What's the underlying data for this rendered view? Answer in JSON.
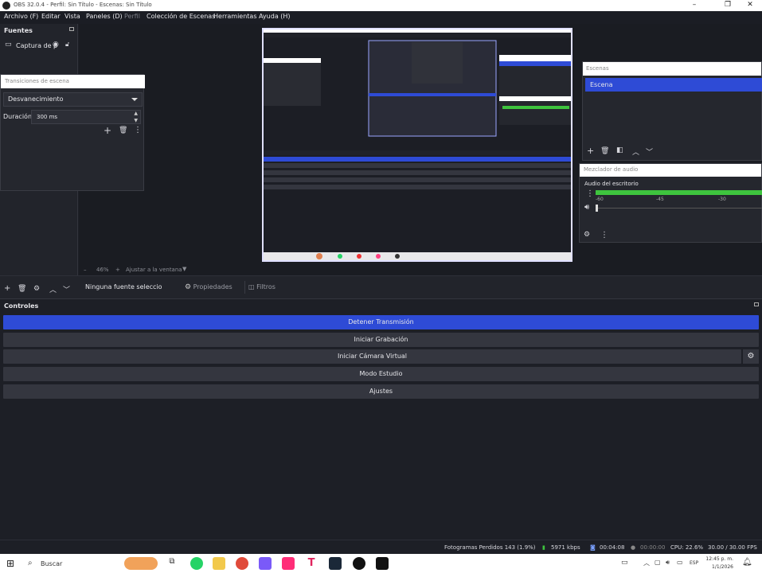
{
  "window": {
    "title": "OBS 32.0.4 - Perfil: Sin Título - Escenas: Sin Título"
  },
  "menu": [
    {
      "label": "Archivo (F)",
      "disabled": false
    },
    {
      "label": "Editar",
      "disabled": false
    },
    {
      "label": "Vista",
      "disabled": false
    },
    {
      "label": "Paneles (D)",
      "disabled": false
    },
    {
      "label": "Perfil",
      "disabled": true
    },
    {
      "label": "Colección de Escenas",
      "disabled": false
    },
    {
      "label": "Herramientas",
      "disabled": false
    },
    {
      "label": "Ayuda (H)",
      "disabled": false
    }
  ],
  "sources": {
    "title": "Fuentes",
    "items": [
      {
        "label": "Captura de p"
      }
    ]
  },
  "transitions": {
    "title": "Transiciones de escena",
    "selected": "Desvanecimiento",
    "duration_label": "Duración",
    "duration_value": "300 ms"
  },
  "scenes": {
    "title": "Escenas",
    "items": [
      {
        "label": "Escena"
      }
    ]
  },
  "mixer": {
    "title": "Mezclador de audio",
    "channel": "Audio del escritorio",
    "scale": [
      "-60",
      "-45",
      "-30"
    ]
  },
  "preview": {
    "zoom": "46%",
    "fit": "Ajustar a la ventana"
  },
  "source_toolbar": {
    "none_selected": "Ninguna fuente seleccionada",
    "properties": "Propiedades",
    "filters": "Filtros"
  },
  "controls": {
    "title": "Controles",
    "buttons": [
      {
        "label": "Detener Transmisión",
        "active": true
      },
      {
        "label": "Iniciar Grabación",
        "active": false
      },
      {
        "label": "Iniciar Cámara Virtual",
        "active": false
      },
      {
        "label": "Modo Estudio",
        "active": false
      },
      {
        "label": "Ajustes",
        "active": false
      }
    ]
  },
  "status": {
    "dropped": "Fotogramas Perdidos 143 (1.9%)",
    "bitrate": "5971 kbps",
    "stream_time": "00:04:08",
    "rec_time": "00:00:00",
    "cpu": "CPU: 22.6%",
    "fps": "30.00 / 30.00 FPS"
  },
  "taskbar": {
    "search": "Buscar",
    "time": "12:45 p. m.",
    "date": "1/1/2026",
    "lang": "ESP"
  },
  "colors": {
    "accent": "#2e4bd6",
    "meter_green": "#3ec43e",
    "background": "#1d1f26"
  }
}
